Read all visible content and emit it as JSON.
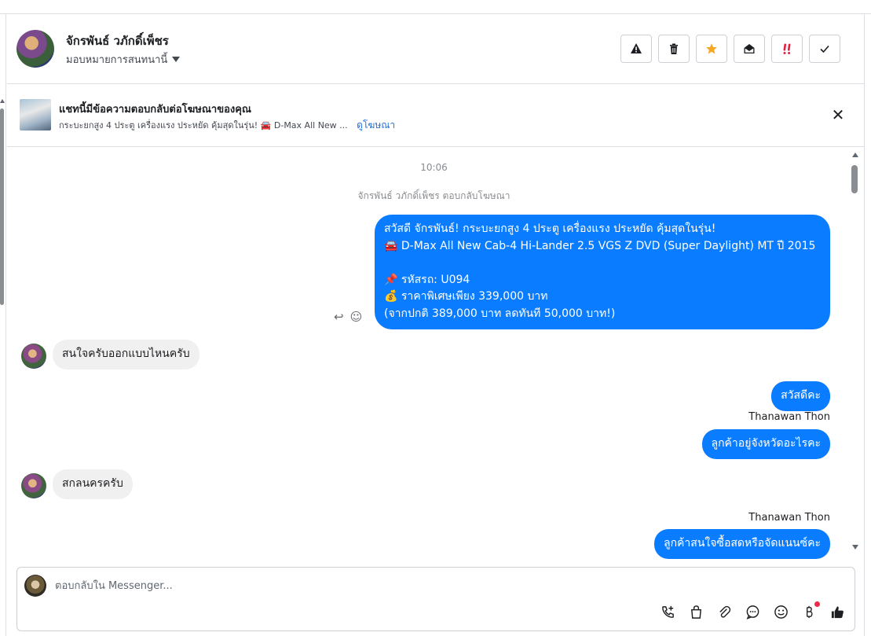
{
  "header": {
    "name": "จักรพันธ์ วภักดิ์เพ็ชร",
    "assign_label": "มอบหมายการสนทนานี้",
    "tools": [
      {
        "name": "report-icon",
        "glyph": "⚠"
      },
      {
        "name": "trash-icon",
        "glyph": "🗑"
      },
      {
        "name": "star-icon",
        "glyph": "★"
      },
      {
        "name": "mark-unread-icon",
        "glyph": "✉"
      },
      {
        "name": "follow-up-icon",
        "glyph": "!!"
      },
      {
        "name": "done-icon",
        "glyph": "✓"
      }
    ]
  },
  "ad_banner": {
    "title": "แชทนี้มีข้อความตอบกลับต่อโฆษณาของคุณ",
    "subtitle": "กระบะยกสูง 4 ประตู เครื่องแรง ประหยัด คุ้มสุดในรุ่น! 🚘 D-Max All New ...",
    "link": "ดูโฆษณา",
    "close": "✕"
  },
  "conversation": {
    "timestamp": "10:06",
    "ad_reply_note": "จักรพันธ์ วภักดิ์เพ็ชร ตอบกลับโฆษณา",
    "ad_message": "สวัสดี จักรพันธ์! กระบะยกสูง 4 ประตู เครื่องแรง ประหยัด คุ้มสุดในรุ่น!\n🚘 D-Max All New Cab-4 Hi-Lander 2.5 VGS Z DVD (Super Daylight) MT ปี 2015\n\n📌 รหัสรถ: U094\n💰 ราคาพิเศษเพียง 339,000 บาท\n(จากปกติ 389,000 บาท ลดทันที 50,000 บาท!)",
    "reply_icon": "↩",
    "emoji_icon": "☺",
    "messages": [
      {
        "text": "สนใจครับออกแบบไหนครับ"
      },
      {
        "text": "สวัสดีคะ"
      },
      {
        "sender": "Thanawan Thon",
        "text": "ลูกค้าอยู่จังหวัดอะไรคะ"
      },
      {
        "text": "สกลนครครับ"
      },
      {
        "sender": "Thanawan Thon",
        "text": "ลูกค้าสนใจซื้อสดหรือจัดแนนซ์คะ"
      }
    ]
  },
  "composer": {
    "placeholder": "ตอบกลับใน Messenger...",
    "tools": [
      "call-add-icon",
      "shopping-bag-icon",
      "attach-icon",
      "saved-reply-icon",
      "emoji-icon",
      "baht-icon",
      "like-icon"
    ]
  }
}
